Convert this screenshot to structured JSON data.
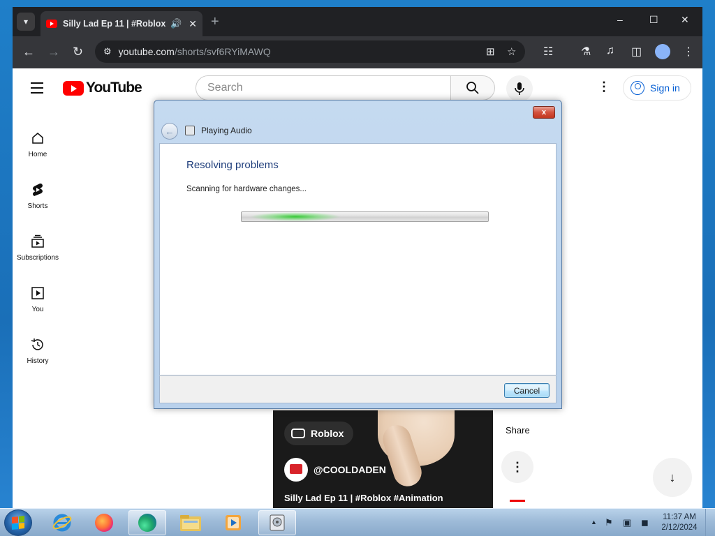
{
  "browser": {
    "tab": {
      "title": "Silly Lad Ep 11 | #Roblox #Animation",
      "audio_icon": "speaker-icon",
      "close_icon": "close-icon"
    },
    "new_tab_label": "+",
    "window_controls": {
      "minimize": "–",
      "maximize": "☐",
      "close": "✕"
    },
    "address": {
      "host": "youtube.com",
      "path": "/shorts/svf6RYiMAWQ"
    }
  },
  "youtube": {
    "logo_text": "YouTube",
    "search": {
      "placeholder": "Search"
    },
    "signin_label": "Sign in",
    "guide": [
      {
        "label": "Home",
        "icon": "home-icon"
      },
      {
        "label": "Shorts",
        "icon": "shorts-icon"
      },
      {
        "label": "Subscriptions",
        "icon": "subscriptions-icon"
      },
      {
        "label": "You",
        "icon": "you-icon"
      },
      {
        "label": "History",
        "icon": "history-icon"
      }
    ],
    "short": {
      "chip_label": "Roblox",
      "channel": "@COOLDADEN",
      "title": "Silly Lad Ep 11 | #Roblox #Animation",
      "share_label": "Share"
    }
  },
  "dialog": {
    "window_title": "Playing Audio",
    "close_label": "x",
    "heading": "Resolving problems",
    "status": "Scanning for hardware changes...",
    "progress_indeterminate": true,
    "cancel_label": "Cancel"
  },
  "taskbar": {
    "apps": [
      "internet-explorer-icon",
      "firefox-icon",
      "edge-icon",
      "file-explorer-icon",
      "media-player-icon",
      "troubleshooter-icon"
    ],
    "clock": {
      "time": "11:37 AM",
      "date": "2/12/2024"
    }
  },
  "colors": {
    "youtube_red": "#ff0000",
    "link_blue": "#065fd4",
    "dialog_heading": "#1e3d7b",
    "progress_green": "#2ec82e"
  }
}
